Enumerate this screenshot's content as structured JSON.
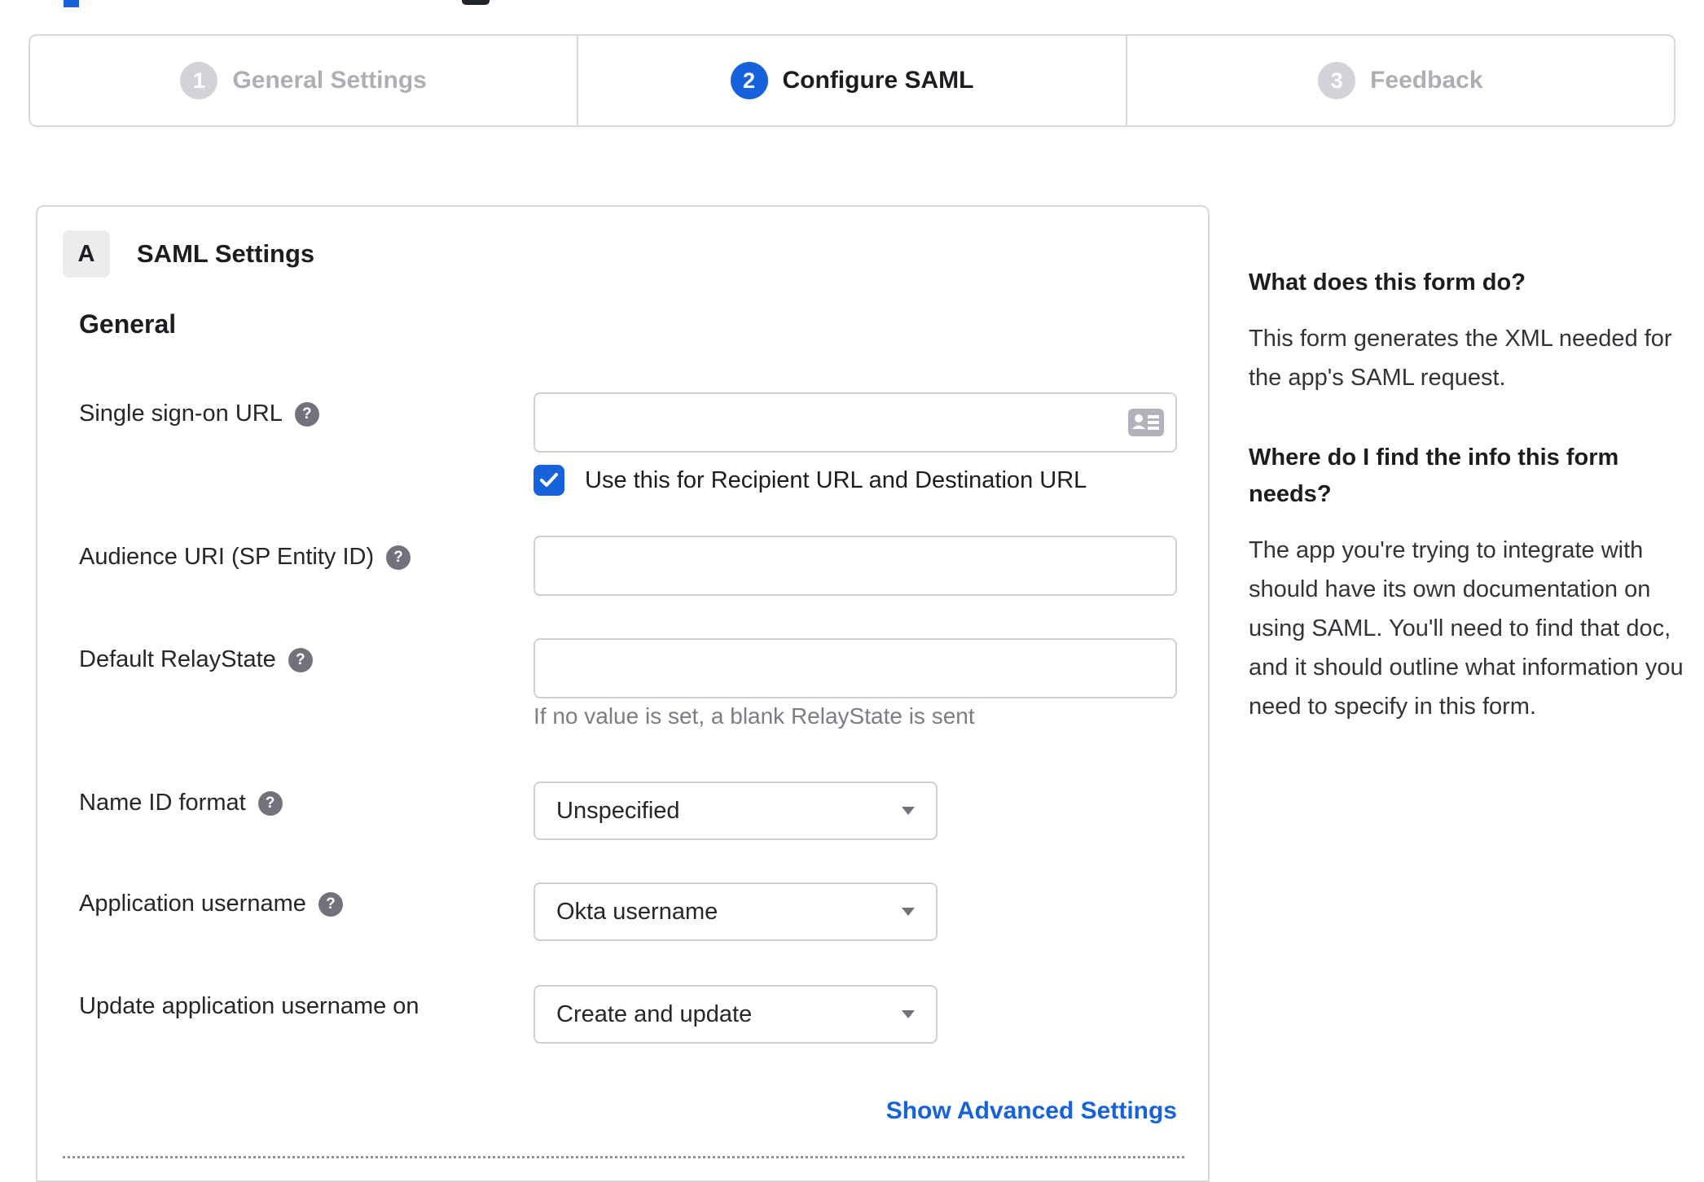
{
  "colors": {
    "accent_blue": "#1662dd",
    "border_gray": "#d7d7dc",
    "text_dark": "#1d1d21",
    "helper_gray": "#7c7c86",
    "inactive_step_gray": "#d2d2d8"
  },
  "stepper": {
    "steps": [
      {
        "number": "1",
        "label": "General Settings",
        "state": "inactive"
      },
      {
        "number": "2",
        "label": "Configure SAML",
        "state": "active"
      },
      {
        "number": "3",
        "label": "Feedback",
        "state": "inactive"
      }
    ]
  },
  "panel": {
    "badge": "A",
    "title": "SAML Settings",
    "section_title": "General",
    "fields": [
      {
        "label": "Single sign-on URL",
        "type": "text",
        "value": "",
        "checkbox": {
          "checked": true,
          "label": "Use this for Recipient URL and Destination URL"
        }
      },
      {
        "label": "Audience URI (SP Entity ID)",
        "type": "text",
        "value": ""
      },
      {
        "label": "Default RelayState",
        "type": "text",
        "value": "",
        "helper": "If no value is set, a blank RelayState is sent"
      },
      {
        "label": "Name ID format",
        "type": "select",
        "value": "Unspecified"
      },
      {
        "label": "Application username",
        "type": "select",
        "value": "Okta username"
      },
      {
        "label": "Update application username on",
        "type": "select",
        "value": "Create and update"
      }
    ],
    "advanced_link": "Show Advanced Settings"
  },
  "sidebar": {
    "sections": [
      {
        "heading": "What does this form do?",
        "body": "This form generates the XML needed for the app's SAML request."
      },
      {
        "heading": "Where do I find the info this form needs?",
        "body": "The app you're trying to integrate with should have its own documentation on using SAML. You'll need to find that doc, and it should outline what information you need to specify in this form."
      }
    ]
  }
}
